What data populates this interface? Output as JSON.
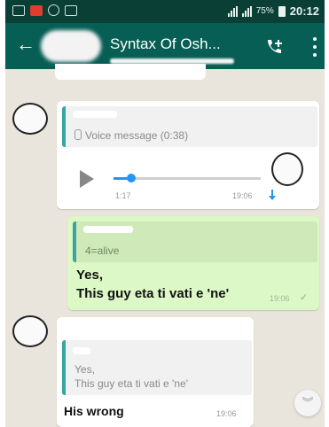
{
  "status_bar": {
    "battery": "75%",
    "time": "20:12"
  },
  "toolbar": {
    "title": "Syntax Of Osh..."
  },
  "colors": {
    "header": "#075e54",
    "status_bar": "#0a3f36",
    "outgoing_bubble": "#dcf8c6",
    "quote_accent": "#35a5a1",
    "progress": "#2196f3"
  },
  "icons": {
    "back": "back-arrow-icon",
    "call_add": "add-call-icon",
    "menu": "menu-icon",
    "play": "play-icon",
    "scroll": "scroll-down-icon"
  },
  "messages": {
    "m1": {
      "quote_text": "Voice message (0:38)",
      "elapsed": "1:17",
      "time": "19:06",
      "progress": 0.12
    },
    "m2": {
      "quote_text": "4=alive",
      "text_line1": "Yes,",
      "text_line2": "This guy eta ti vati e 'ne'",
      "time": "19:06",
      "check": "✓"
    },
    "m3": {
      "quote_line1": "Yes,",
      "quote_line2": "This guy eta ti vati e 'ne'",
      "text": "His wrong",
      "time": "19:06"
    }
  },
  "scroll_button": {
    "glyph": "︾"
  }
}
